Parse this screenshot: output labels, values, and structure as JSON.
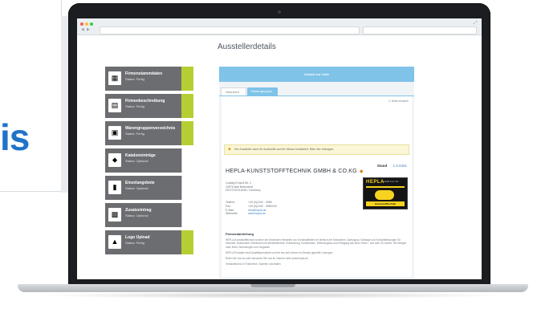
{
  "side_word": "is",
  "page_title": "Ausstellerdetails",
  "sidebar": {
    "steps": [
      {
        "title": "Firmenstammdaten",
        "status": "Status: Fertig",
        "state": "done",
        "icon": "building-icon",
        "glyph": "▦"
      },
      {
        "title": "Firmenbeschreibung",
        "status": "Status: Fertig",
        "state": "done",
        "icon": "book-icon",
        "glyph": "▤"
      },
      {
        "title": "Warengruppenverzeichnis",
        "status": "Status: Fertig",
        "state": "done",
        "icon": "boxes-icon",
        "glyph": "▣"
      },
      {
        "title": "Kataloneinträge",
        "status": "Status: Optional",
        "state": "open",
        "icon": "tag-icon",
        "glyph": "⬥"
      },
      {
        "title": "Einzelangebote",
        "status": "Status: Optional",
        "state": "open",
        "icon": "user-icon",
        "glyph": "▮"
      },
      {
        "title": "Zusatzeintrag",
        "status": "Status: Optional",
        "state": "open",
        "icon": "image-icon",
        "glyph": "▩"
      },
      {
        "title": "Logo Upload",
        "status": "Status: Fertig",
        "state": "done",
        "icon": "upload-icon",
        "glyph": "▲"
      }
    ]
  },
  "main": {
    "back_button": "Zurück zur Liste",
    "tabs": [
      {
        "label": "Übersicht",
        "active": false
      },
      {
        "label": "Warengruppen",
        "active": true
      }
    ],
    "print_link": "Seite drucken",
    "notice": "Der Aussteller kann für Auskünfte auf der Messe kontaktiert. Bitte hier eintragen.",
    "stand_label": "Stand",
    "stand_value": "1.0.0401",
    "company_name": "HEPLA-KUNSTSTOFFTECHNIK GMBH & CO.KG",
    "address": [
      "Ludwig-Erhard-Str. 2",
      "24576 Bad Bramstedt",
      "DEUTSCHLAND / Germany"
    ],
    "contacts": [
      {
        "key": "Telefon:",
        "value": "+49 (0)4192 - 9980",
        "link": false
      },
      {
        "key": "Fax:",
        "value": "+49 (0)4192 - 9980100",
        "link": false
      },
      {
        "key": "E-Mail:",
        "value": "info@hepla.de",
        "link": true
      },
      {
        "key": "Webseite:",
        "value": "www.hepla.de",
        "link": true
      }
    ],
    "logo": {
      "brand": "HEPLA",
      "small": "GmbH & Co. KG",
      "tagline": "KunststoffTechnik"
    },
    "description_heading": "Firmendarstellung",
    "description": [
      "HEPLA-Kunststofftechnik ist einer der führenden Hersteller von Kunststoffteilen im Bereich der Kleinserien, Spritzguss, Montage und Komplettlösungen für Industrie, Automotive, Elektronik und Medizintechnik. Entwicklung, Konstruktion, Werkzeugbau und Fertigung aus einer Hand – seit über 40 Jahren. Wir fertigen nach Ihren Zeichnungen und Vorgaben.",
      "HEPLA Produkte sind Qualitätsprodukte und bei uns seit Jahren im Einsatz geprüfte Lösungen.",
      "Rufen Sie uns an oder besuchen Sie uns im Internet unter www.hepla.de",
      "Verkaufsbüros in Frankreich, Spanien und Italien"
    ]
  }
}
